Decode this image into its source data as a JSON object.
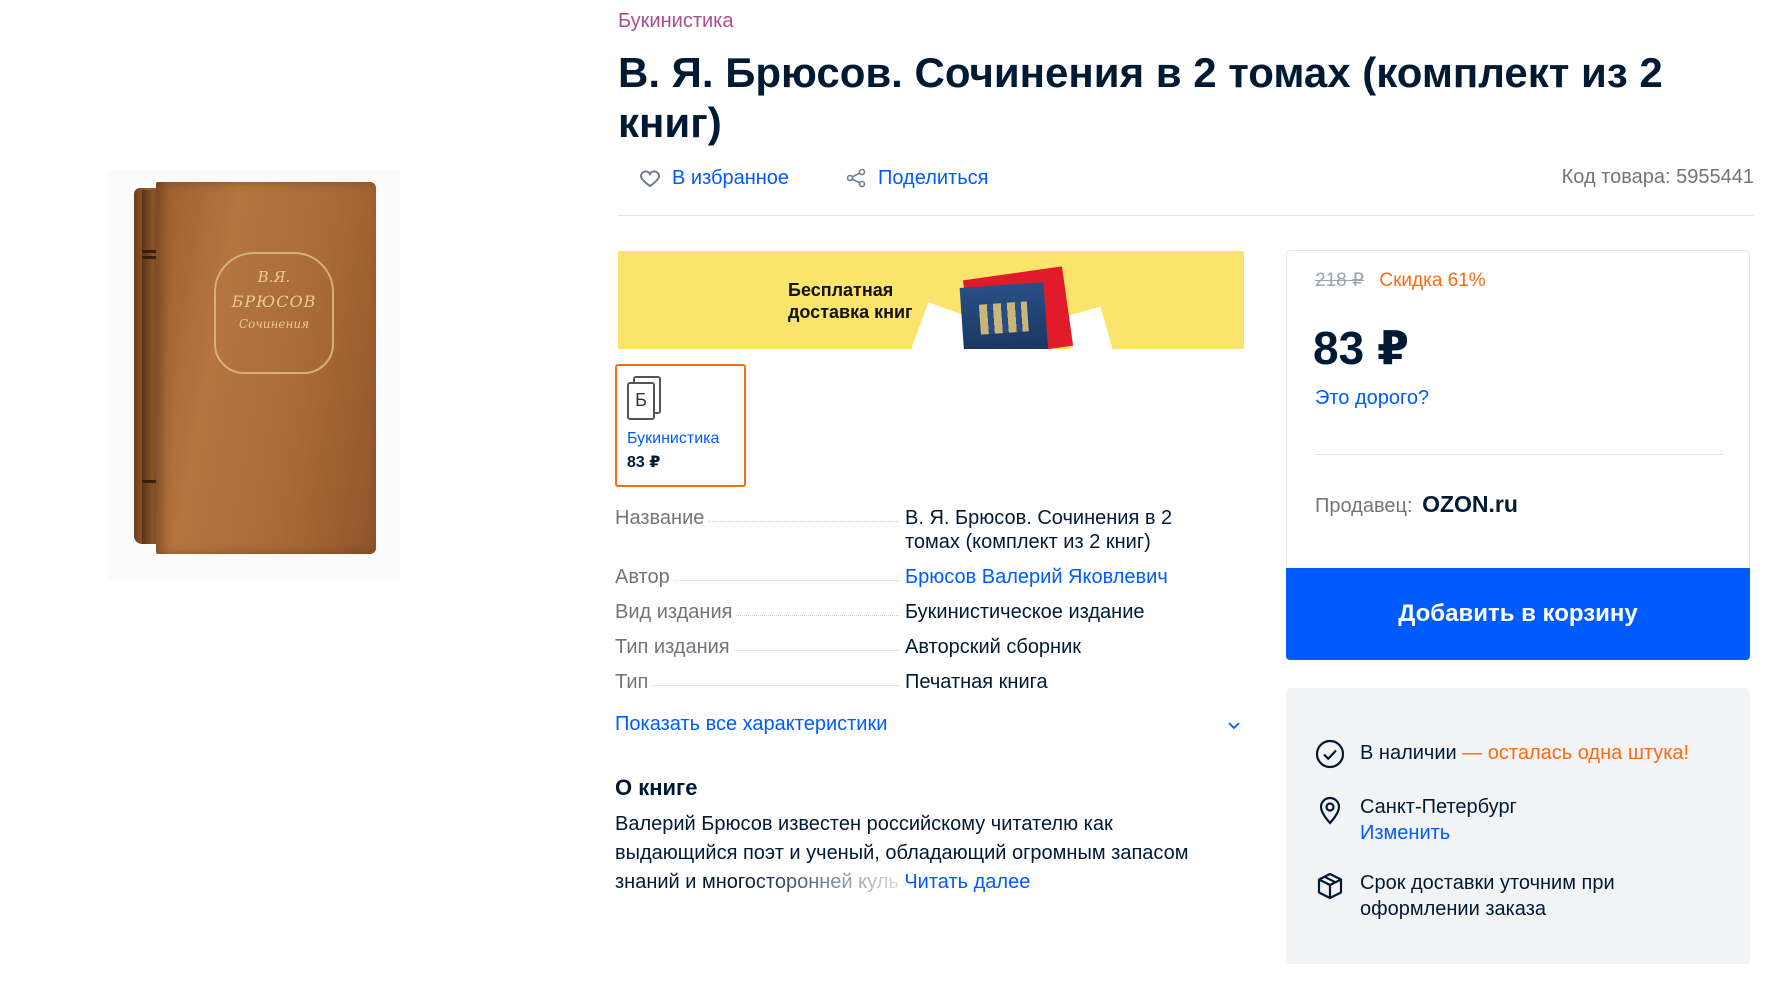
{
  "breadcrumb": {
    "category": "Букинистика"
  },
  "product": {
    "title": "В. Я. Брюсов. Сочинения в 2 томах (комплект из 2 книг)",
    "cover_text": {
      "line1": "В.Я.",
      "line2": "БРЮСОВ",
      "line3": "Сочинения"
    }
  },
  "actions": {
    "favorite_label": "В избранное",
    "share_label": "Поделиться",
    "sku_text": "Код товара: 5955441"
  },
  "banner": {
    "line1": "Бесплатная",
    "line2": "доставка книг"
  },
  "variant": {
    "icon_letter": "Б",
    "label": "Букинистика",
    "price": "83 ₽"
  },
  "characteristics": {
    "rows": [
      {
        "key": "Название",
        "value": "В. Я. Брюсов. Сочинения в 2 томах (комплект из 2 книг)"
      },
      {
        "key": "Автор",
        "value": "Брюсов Валерий Яковлевич"
      },
      {
        "key": "Вид издания",
        "value": "Букинистическое издание"
      },
      {
        "key": "Тип издания",
        "value": "Авторский сборник"
      },
      {
        "key": "Тип",
        "value": "Печатная книга"
      }
    ],
    "show_all": "Показать все характеристики"
  },
  "about": {
    "title": "О книге",
    "line1": "Валерий Брюсов известен российскому читателю как",
    "line2": "выдающийся поэт и ученый, обладающий огромным запасом",
    "line3": "знаний и многосторонней куль",
    "read_more": "Читать далее"
  },
  "price_panel": {
    "old_price": "218 ₽",
    "discount": "Скидка 61%",
    "price": "83 ₽",
    "expensive_link": "Это дорого?",
    "seller_label": "Продавец:",
    "seller_name": "OZON.ru",
    "cart_button": "Добавить в корзину"
  },
  "delivery": {
    "stock": "В наличии",
    "stock_note": " — осталась одна штука!",
    "city": "Санкт-Петербург",
    "change_link": "Изменить",
    "term_line1": "Срок доставки уточним при",
    "term_line2": "оформлении заказа"
  },
  "colors": {
    "accent_blue": "#005bff",
    "discount_orange": "#f96c12",
    "category_purple": "#a94e8f",
    "banner_yellow": "#fbe46b"
  }
}
